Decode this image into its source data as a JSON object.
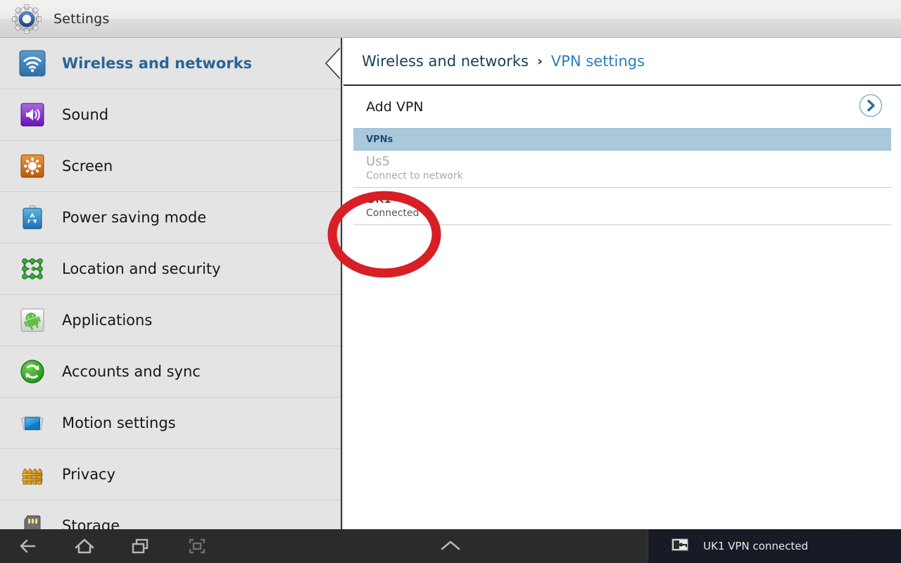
{
  "titlebar": {
    "icon": "settings-gear-icon",
    "title": "Settings"
  },
  "sidebar": {
    "items": [
      {
        "label": "Wireless and networks",
        "icon": "wifi-icon",
        "selected": true
      },
      {
        "label": "Sound",
        "icon": "speaker-icon",
        "selected": false
      },
      {
        "label": "Screen",
        "icon": "brightness-icon",
        "selected": false
      },
      {
        "label": "Power saving mode",
        "icon": "recycle-battery-icon",
        "selected": false
      },
      {
        "label": "Location and security",
        "icon": "location-grid-icon",
        "selected": false
      },
      {
        "label": "Applications",
        "icon": "android-robot-icon",
        "selected": false
      },
      {
        "label": "Accounts and sync",
        "icon": "sync-refresh-icon",
        "selected": false
      },
      {
        "label": "Motion settings",
        "icon": "motion-tablet-icon",
        "selected": false
      },
      {
        "label": "Privacy",
        "icon": "fence-icon",
        "selected": false
      },
      {
        "label": "Storage",
        "icon": "sdcard-icon",
        "selected": false
      }
    ]
  },
  "main": {
    "breadcrumb": {
      "parent": "Wireless and networks",
      "separator": "›",
      "current": "VPN settings"
    },
    "add_vpn": {
      "label": "Add VPN",
      "chevron_icon": "chevron-right-circle-icon"
    },
    "section": {
      "label": "VPNs"
    },
    "vpn_list": [
      {
        "name": "Us5",
        "status": "Connect to network",
        "state": "disconnected"
      },
      {
        "name": "UK1",
        "status": "Connected",
        "state": "connected"
      }
    ]
  },
  "annotation": {
    "shape": "ellipse",
    "color": "#d81f26",
    "target": "UK1"
  },
  "navbar": {
    "buttons": [
      {
        "name": "back-button",
        "icon": "back-arrow-icon"
      },
      {
        "name": "home-button",
        "icon": "home-icon"
      },
      {
        "name": "recents-button",
        "icon": "recent-apps-icon"
      },
      {
        "name": "screenshot-button",
        "icon": "screen-capture-icon"
      }
    ],
    "collapse_icon": "chevron-up-icon",
    "status": {
      "icon": "vpn-key-icon",
      "text": "UK1 VPN connected"
    }
  },
  "colors": {
    "accent_blue": "#2a7fb8",
    "breadcrumb_dark": "#17405e",
    "section_band": "#a9c8dc",
    "annotation_red": "#d81f26",
    "navbar_bg": "#2b2b2b"
  }
}
